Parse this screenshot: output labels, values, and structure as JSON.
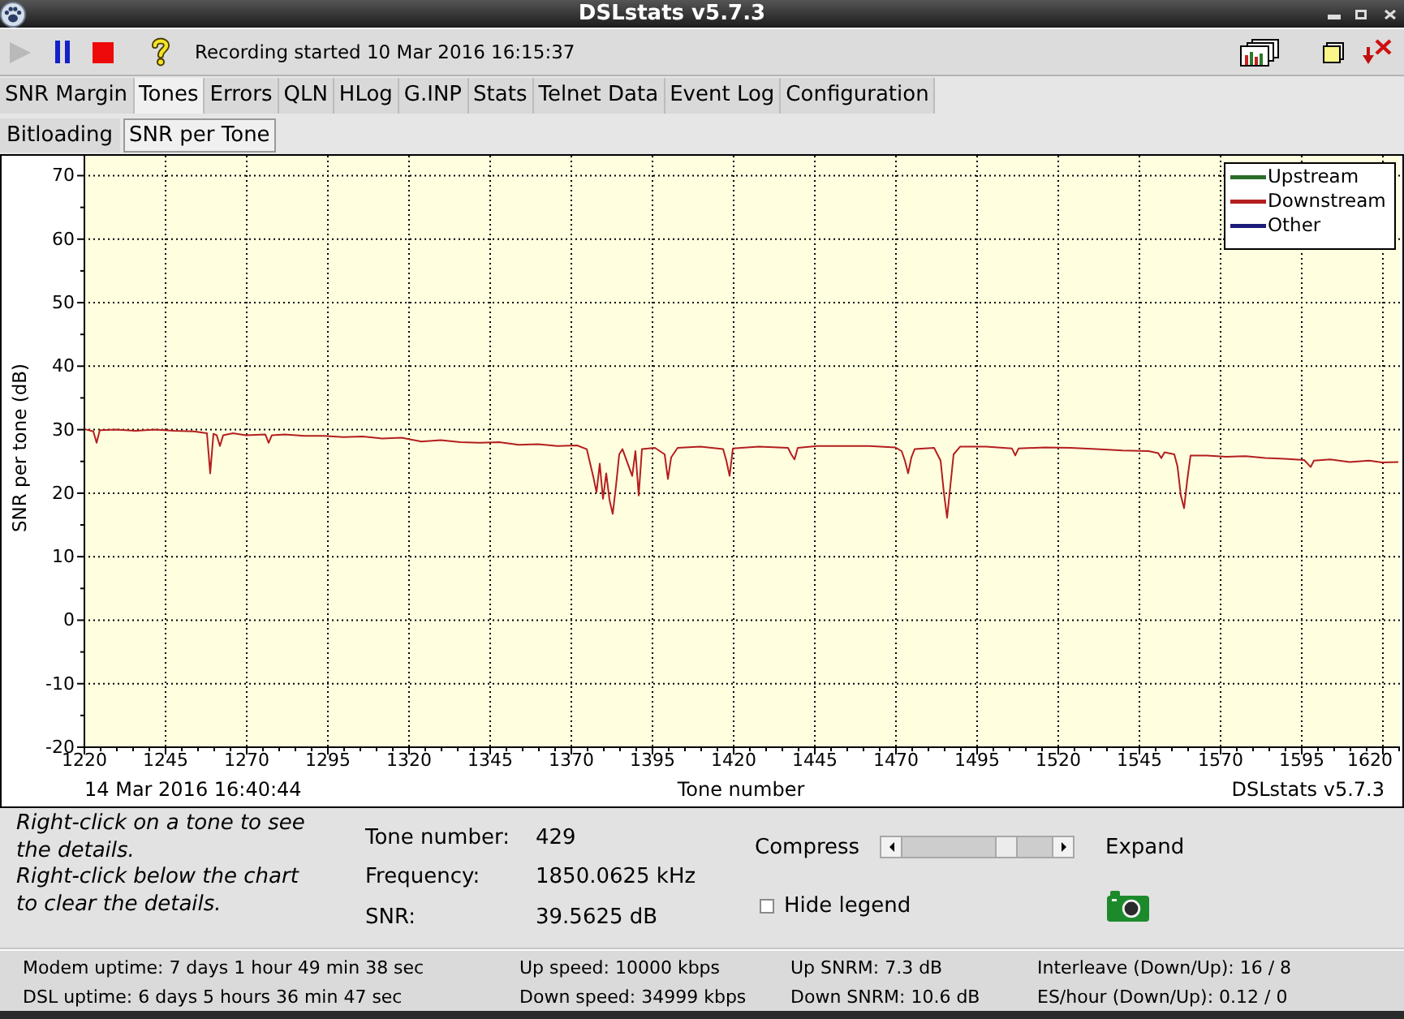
{
  "window": {
    "title": "DSLstats v5.7.3"
  },
  "toolbar": {
    "buttons": [
      {
        "kind": "play",
        "disabled": true
      },
      {
        "kind": "pause",
        "disabled": false
      },
      {
        "kind": "stop",
        "disabled": false
      },
      {
        "kind": "help",
        "disabled": false
      }
    ],
    "status": "Recording started 10 Mar 2016 16:15:37"
  },
  "tabs": [
    {
      "label": "SNR Margin",
      "selected": false
    },
    {
      "label": "Tones",
      "selected": true
    },
    {
      "label": "Errors",
      "selected": false
    },
    {
      "label": "QLN",
      "selected": false
    },
    {
      "label": "HLog",
      "selected": false
    },
    {
      "label": "G.INP",
      "selected": false
    },
    {
      "label": "Stats",
      "selected": false
    },
    {
      "label": "Telnet Data",
      "selected": false
    },
    {
      "label": "Event Log",
      "selected": false
    },
    {
      "label": "Configuration",
      "selected": false
    }
  ],
  "subtabs": [
    {
      "label": "Bitloading",
      "selected": false
    },
    {
      "label": "SNR per Tone",
      "selected": true
    }
  ],
  "chart_panel": {
    "chart_data": {
      "type": "line",
      "grid": true,
      "xlabel": "Tone number",
      "ylabel": "SNR per tone (dB)",
      "xlim": [
        1220,
        1625
      ],
      "ylim": [
        -20,
        73
      ],
      "xticks": [
        1220,
        1245,
        1270,
        1295,
        1320,
        1345,
        1370,
        1395,
        1420,
        1445,
        1470,
        1495,
        1520,
        1545,
        1570,
        1595,
        1620
      ],
      "yticks": [
        -20,
        -10,
        0,
        10,
        20,
        30,
        40,
        50,
        60,
        70
      ],
      "x": [
        1220,
        1223,
        1224,
        1225,
        1230,
        1236,
        1242,
        1248,
        1254,
        1258,
        1259,
        1260,
        1261,
        1262,
        1263,
        1266,
        1270,
        1276,
        1277,
        1278,
        1282,
        1288,
        1294,
        1300,
        1306,
        1312,
        1318,
        1324,
        1330,
        1336,
        1342,
        1348,
        1354,
        1360,
        1366,
        1372,
        1375,
        1377,
        1378,
        1379,
        1380,
        1381,
        1382,
        1383,
        1384,
        1385,
        1386,
        1388,
        1389,
        1390,
        1391,
        1392,
        1396,
        1399,
        1400,
        1401,
        1403,
        1410,
        1417,
        1418,
        1419,
        1420,
        1428,
        1437,
        1438,
        1439,
        1440,
        1446,
        1454,
        1462,
        1470,
        1472,
        1473,
        1474,
        1475,
        1476,
        1482,
        1484,
        1485,
        1486,
        1487,
        1488,
        1490,
        1498,
        1506,
        1507,
        1508,
        1516,
        1524,
        1532,
        1540,
        1548,
        1551,
        1552,
        1553,
        1556,
        1557,
        1558,
        1559,
        1560,
        1561,
        1566,
        1572,
        1578,
        1584,
        1590,
        1596,
        1598,
        1599,
        1604,
        1610,
        1616,
        1620,
        1625
      ],
      "series": [
        {
          "name": "Upstream",
          "color": "#2a6e2a",
          "values": [
            null,
            null,
            null,
            null,
            null,
            null,
            null,
            null,
            null,
            null,
            null,
            null,
            null,
            null,
            null,
            null,
            null,
            null,
            null,
            null,
            null,
            null,
            null,
            null,
            null,
            null,
            null,
            null,
            null,
            null,
            null,
            null,
            null,
            null,
            null,
            null,
            null,
            null,
            null,
            null,
            null,
            null,
            null,
            null,
            null,
            null,
            null,
            null,
            null,
            null,
            null,
            null,
            null,
            null,
            null,
            null,
            null,
            null,
            null,
            null,
            null,
            null,
            null,
            null,
            null,
            null,
            null,
            null,
            null,
            null,
            null,
            null,
            null,
            null,
            null,
            null,
            null,
            null,
            null,
            null,
            null,
            null,
            null,
            null,
            null,
            null,
            null,
            null,
            null,
            null,
            null,
            null,
            null,
            null,
            null,
            null,
            null,
            null,
            null,
            null,
            null,
            null,
            null,
            null,
            null,
            null,
            null,
            null,
            null,
            null,
            null,
            null,
            null,
            null
          ]
        },
        {
          "name": "Downstream",
          "color": "#b41e1e",
          "values": [
            30.0,
            29.6,
            27.8,
            29.8,
            29.9,
            29.7,
            29.9,
            29.7,
            29.6,
            29.3,
            23.0,
            29.2,
            29.0,
            27.3,
            29.0,
            29.3,
            29.0,
            29.1,
            27.8,
            29.0,
            29.1,
            28.9,
            28.9,
            28.7,
            28.8,
            28.5,
            28.6,
            28.0,
            28.2,
            27.9,
            27.8,
            27.9,
            27.5,
            27.6,
            27.3,
            27.4,
            26.8,
            22.5,
            20.0,
            24.5,
            19.0,
            23.0,
            18.8,
            16.6,
            21.0,
            26.0,
            26.8,
            24.0,
            22.6,
            26.5,
            19.5,
            26.8,
            27.0,
            26.0,
            22.1,
            25.5,
            27.0,
            27.2,
            26.8,
            25.0,
            22.6,
            26.9,
            27.2,
            27.0,
            26.0,
            25.2,
            27.0,
            27.3,
            27.3,
            27.3,
            27.1,
            26.5,
            25.0,
            23.0,
            25.5,
            26.8,
            27.0,
            25.0,
            20.0,
            16.0,
            21.0,
            26.0,
            27.2,
            27.2,
            26.9,
            25.8,
            26.9,
            27.1,
            27.0,
            26.8,
            26.6,
            26.5,
            26.2,
            25.4,
            26.3,
            26.0,
            24.0,
            19.5,
            17.5,
            22.0,
            25.8,
            25.8,
            25.6,
            25.7,
            25.4,
            25.3,
            25.1,
            24.0,
            25.0,
            25.2,
            24.8,
            25.0,
            24.7,
            24.8
          ]
        },
        {
          "name": "Other",
          "color": "#1c1c7a",
          "values": [
            null,
            null,
            null,
            null,
            null,
            null,
            null,
            null,
            null,
            null,
            null,
            null,
            null,
            null,
            null,
            null,
            null,
            null,
            null,
            null,
            null,
            null,
            null,
            null,
            null,
            null,
            null,
            null,
            null,
            null,
            null,
            null,
            null,
            null,
            null,
            null,
            null,
            null,
            null,
            null,
            null,
            null,
            null,
            null,
            null,
            null,
            null,
            null,
            null,
            null,
            null,
            null,
            null,
            null,
            null,
            null,
            null,
            null,
            null,
            null,
            null,
            null,
            null,
            null,
            null,
            null,
            null,
            null,
            null,
            null,
            null,
            null,
            null,
            null,
            null,
            null,
            null,
            null,
            null,
            null,
            null,
            null,
            null,
            null,
            null,
            null,
            null,
            null,
            null,
            null,
            null,
            null,
            null,
            null,
            null,
            null,
            null,
            null,
            null,
            null,
            null,
            null,
            null,
            null,
            null,
            null,
            null,
            null,
            null,
            null,
            null,
            null,
            null,
            null
          ]
        }
      ]
    },
    "timestamp": "14 Mar 2016 16:40:44",
    "credit": "DSLstats v5.7.3"
  },
  "details_panel": {
    "hints": [
      "Right-click on a tone to see the details.",
      "Right-click below the chart to clear the details."
    ],
    "fields": [
      {
        "label": "Tone number:",
        "value": "429"
      },
      {
        "label": "Frequency:",
        "value": "1850.0625 kHz"
      },
      {
        "label": "SNR:",
        "value": "39.5625 dB"
      }
    ],
    "zoom": {
      "left_label": "Compress",
      "right_label": "Expand",
      "level": 0.75
    },
    "hide_legend": {
      "label": "Hide legend",
      "checked": false
    }
  },
  "status_bar": {
    "columns": [
      [
        "Modem uptime: 7 days 1 hour 49 min 38 sec",
        "DSL uptime: 6 days 5 hours 36 min 47 sec"
      ],
      [
        "Up speed: 10000 kbps",
        "Down speed: 34999 kbps"
      ],
      [
        "Up SNRM: 7.3 dB",
        "Down SNRM: 10.6 dB"
      ],
      [
        "Interleave (Down/Up): 16 / 8",
        "ES/hour (Down/Up): 0.12 / 0"
      ]
    ]
  }
}
